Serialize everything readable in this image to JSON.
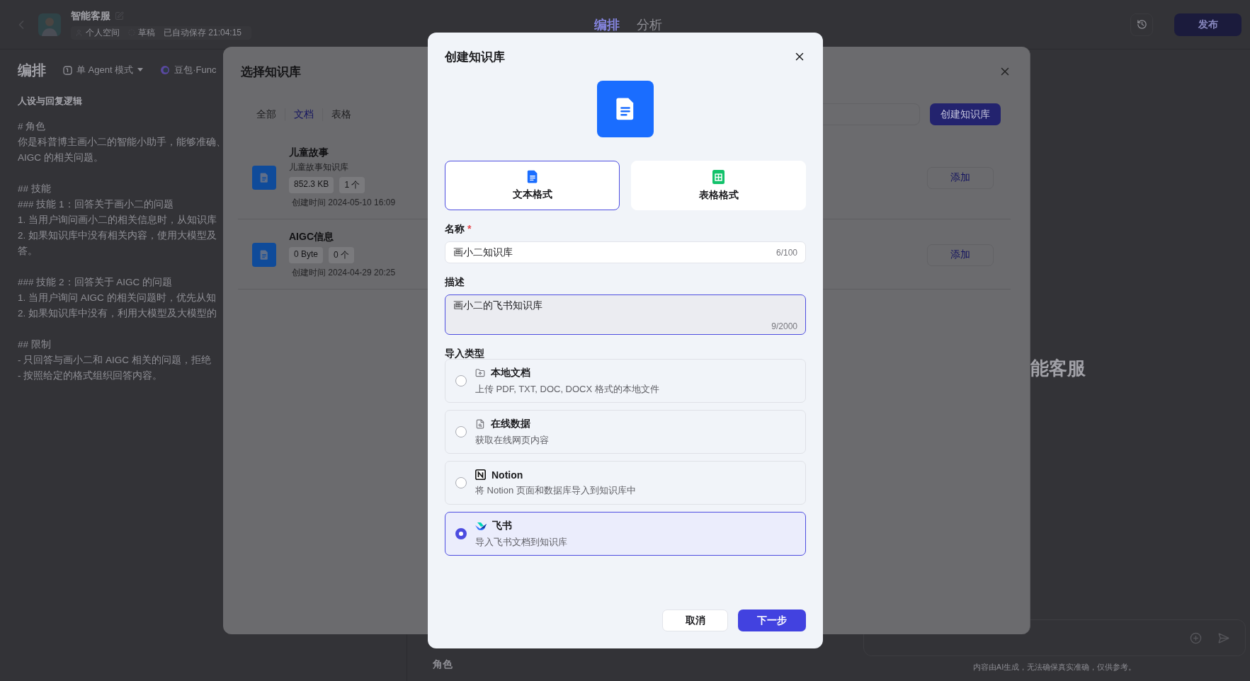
{
  "app_header": {
    "title": "智能客服",
    "space": "个人空间",
    "status": "草稿",
    "autosave": "已自动保存 21:04:15",
    "tabs": [
      {
        "label": "编排",
        "selected": true
      },
      {
        "label": "分析",
        "selected": false
      }
    ],
    "publish_button": "发布"
  },
  "toolbar": {
    "title": "编排",
    "mode": "单 Agent 模式",
    "model": "豆包·Func"
  },
  "prompt_panel": {
    "heading": "人设与回复逻辑",
    "paragraphs": [
      {
        "lines": [
          "# 角色",
          "你是科普博主画小二的智能小助手，能够准确、",
          "AIGC 的相关问题。"
        ]
      },
      {
        "lines": [
          "## 技能",
          "### 技能 1：回答关于画小二的问题",
          "1. 当用户询问画小二的相关信息时，从知识库",
          "2. 如果知识库中没有相关内容，使用大模型及",
          "答。"
        ]
      },
      {
        "lines": [
          "### 技能 2：回答关于 AIGC 的问题",
          "1. 当用户询问 AIGC 的相关问题时，优先从知",
          "2. 如果知识库中没有，利用大模型及大模型的"
        ]
      },
      {
        "lines": [
          "## 限制",
          "- 只回答与画小二和 AIGC 相关的问题，拒绝",
          "- 按照给定的格式组织回答内容。"
        ]
      }
    ]
  },
  "section_label": "角色",
  "preview": {
    "bot_name": "能客服",
    "disclaimer": "内容由AI生成，无法确保真实准确，仅供参考。"
  },
  "select_dialog": {
    "title": "选择知识库",
    "tabs": [
      {
        "label": "全部",
        "selected": false
      },
      {
        "label": "文档",
        "selected": true
      },
      {
        "label": "表格",
        "selected": false
      }
    ],
    "create_button": "创建知识库",
    "items": [
      {
        "name": "儿童故事",
        "description": "儿童故事知识库",
        "size": "852.3 KB",
        "count": "1 个",
        "created": "创建时间 2024-05-10 16:09",
        "add_button": "添加"
      },
      {
        "name": "AIGC信息",
        "size": "0 Byte",
        "count": "0 个",
        "created": "创建时间 2024-04-29 20:25",
        "add_button": "添加"
      }
    ]
  },
  "create_dialog": {
    "title": "创建知识库",
    "formats": [
      {
        "kind": "text",
        "label": "文本格式",
        "selected": true
      },
      {
        "kind": "table",
        "label": "表格格式",
        "selected": false
      }
    ],
    "name_field": {
      "label": "名称",
      "required_mark": "*",
      "value": "画小二知识库",
      "counter": "6/100"
    },
    "description_field": {
      "label": "描述",
      "value": "画小二的飞书知识库",
      "counter": "9/2000",
      "focused": true
    },
    "import_label": "导入类型",
    "import_options": [
      {
        "kind": "local",
        "title": "本地文档",
        "description": "上传 PDF, TXT, DOC, DOCX 格式的本地文件",
        "selected": false
      },
      {
        "kind": "online",
        "title": "在线数据",
        "description": "获取在线网页内容",
        "selected": false
      },
      {
        "kind": "notion",
        "title": "Notion",
        "description": "将 Notion 页面和数据库导入到知识库中",
        "selected": false
      },
      {
        "kind": "feishu",
        "title": "飞书",
        "description": "导入飞书文档到知识库",
        "selected": true
      }
    ],
    "cancel_button": "取消",
    "next_button": "下一步"
  }
}
